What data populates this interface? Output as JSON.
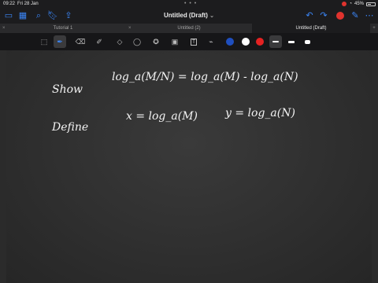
{
  "status": {
    "time": "09:22",
    "date": "Fri 28 Jan",
    "battery": "45%"
  },
  "nav": {
    "title": "Untitled (Draft)",
    "chevron": "⌄"
  },
  "tabs": [
    {
      "label": "Tutorial 1",
      "active": false
    },
    {
      "label": "Untitled (2)",
      "active": false
    },
    {
      "label": "Untitled (Draft)",
      "active": true
    }
  ],
  "tab_close": "×",
  "tab_add": "+",
  "toolbar": {
    "colors": [
      "#1f4fbf",
      "#ffffff",
      "#e52222"
    ],
    "active_tool": "pen"
  },
  "board": {
    "row1_label": "Show",
    "row1_expr": "log_a(M/N) = log_a(M) - log_a(N)",
    "row2_label": "Define",
    "row2_expr1": "x = log_a(M)",
    "row2_expr2": "y = log_a(N)"
  }
}
